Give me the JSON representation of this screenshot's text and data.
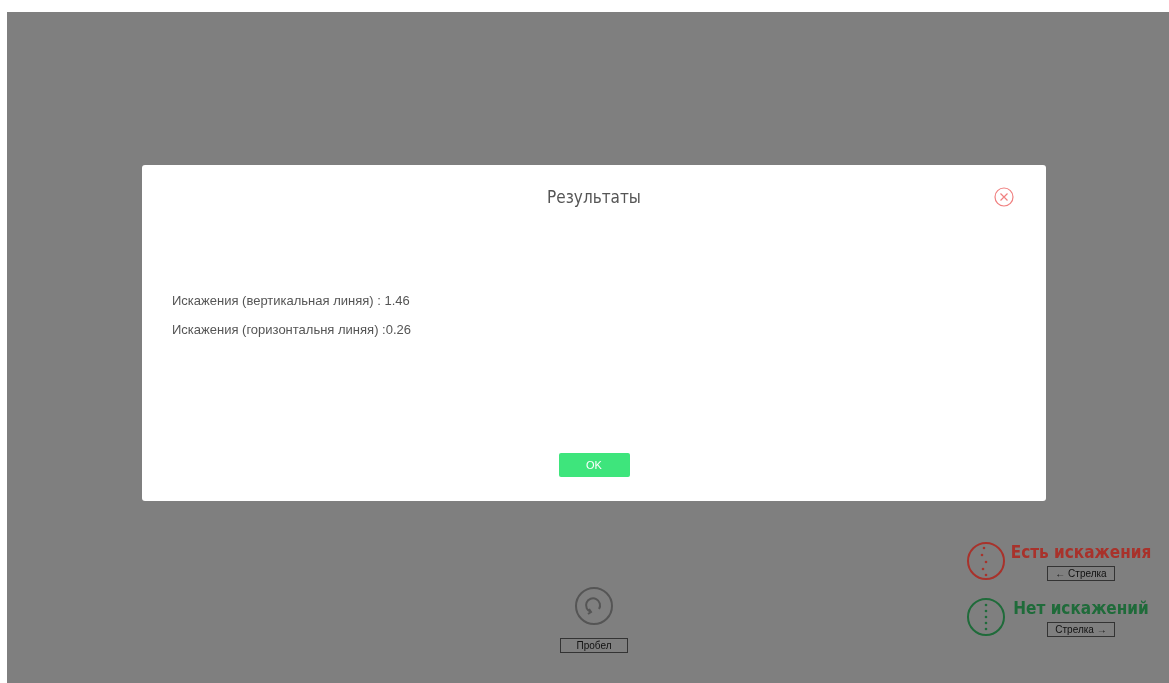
{
  "dialog": {
    "title": "Результаты",
    "lines": [
      "Искажения (вертикальная линяя) : 1.46",
      "Искажения (горизонтальня линяя) :0.26"
    ],
    "ok_button": "OK"
  },
  "replay": {
    "key": "Пробел"
  },
  "answers": [
    {
      "kind": "yes",
      "label": "Есть искажения",
      "key": "← Стрелка",
      "color": "#a8322b"
    },
    {
      "kind": "no",
      "label": "Нет искажений",
      "key": "Стрелка →",
      "color": "#1f6b3a"
    }
  ]
}
